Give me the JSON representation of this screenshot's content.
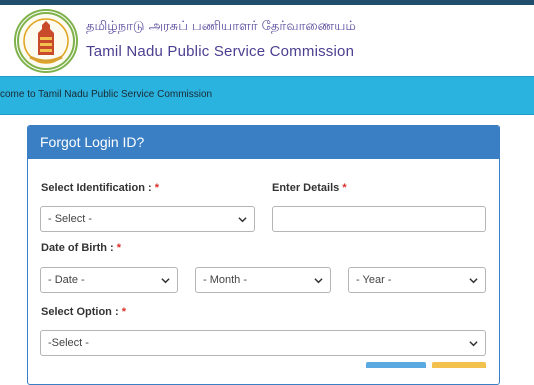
{
  "header": {
    "title_tamil": "தமிழ்நாடு அரசுப் பணியாளர் தேர்வாணையம்",
    "title_english": "Tamil Nadu Public Service Commission",
    "emblem_icon": "tamil-nadu-emblem-icon"
  },
  "marquee": {
    "text": "come to Tamil Nadu Public Service Commission"
  },
  "form": {
    "title": "Forgot Login ID?",
    "identification_label": "Select Identification : ",
    "identification_value": "- Select -",
    "details_label": "Enter Details ",
    "details_value": "",
    "dob_label": "Date of Birth : ",
    "date_value": "- Date -",
    "month_value": "- Month -",
    "year_value": "- Year -",
    "option_label": "Select Option : ",
    "option_value": "-Select -",
    "required_mark": "*"
  },
  "colors": {
    "topbar": "#1f4d6b",
    "marquee_bg": "#2bb3e0",
    "card_header": "#3a7fc4",
    "required": "#d9302c"
  }
}
